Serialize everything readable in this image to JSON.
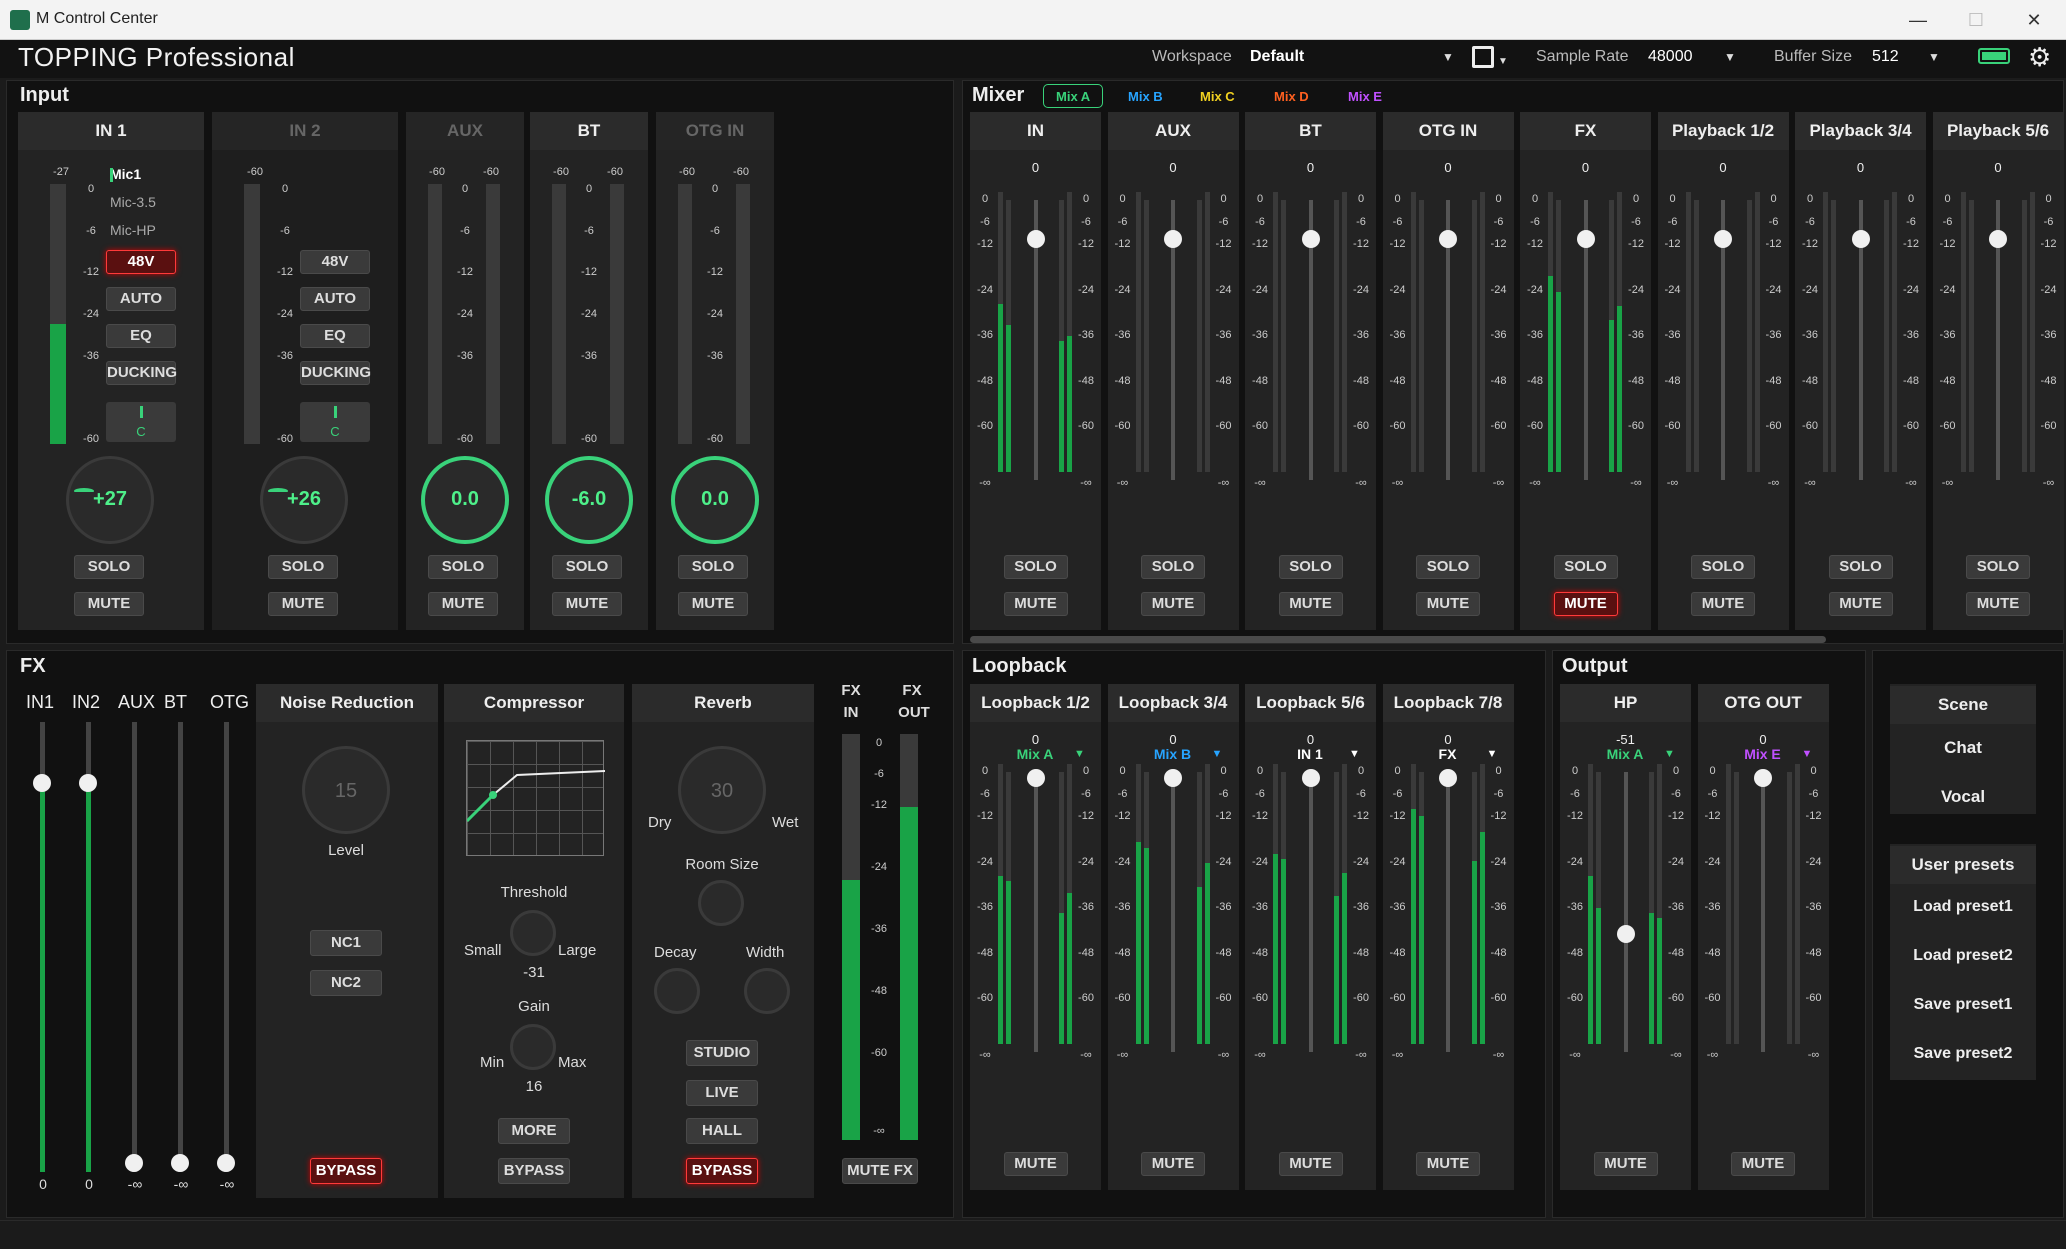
{
  "window": {
    "title": "M Control Center",
    "minimize": "—",
    "maximize": "☐",
    "close": "✕"
  },
  "header": {
    "brand": "TOPPING Professional",
    "workspace_label": "Workspace",
    "workspace_value": "Default",
    "sample_rate_label": "Sample Rate",
    "sample_rate_value": "48000",
    "buffer_label": "Buffer Size",
    "buffer_value": "512",
    "save_icon": "save-icon",
    "settings_icon": "gear-icon",
    "battery_icon": "battery-icon"
  },
  "input": {
    "title": "Input",
    "channels": [
      {
        "label": "IN 1",
        "top_tick": "-27",
        "sources": [
          "Mic1",
          "Mic-3.5",
          "Mic-HP"
        ],
        "buttons": [
          "48V",
          "AUTO",
          "EQ",
          "DUCKING"
        ],
        "pan": "C",
        "gain": "+27",
        "solo": "SOLO",
        "mute": "MUTE",
        "level": 0.46
      },
      {
        "label": "IN 2",
        "top_tick": "-60",
        "buttons": [
          "48V",
          "AUTO",
          "EQ",
          "DUCKING"
        ],
        "pan": "C",
        "gain": "+26",
        "solo": "SOLO",
        "mute": "MUTE"
      },
      {
        "label": "AUX",
        "gain": "0.0",
        "solo": "SOLO",
        "mute": "MUTE"
      },
      {
        "label": "BT",
        "gain": "-6.0",
        "solo": "SOLO",
        "mute": "MUTE"
      },
      {
        "label": "OTG IN",
        "gain": "0.0",
        "solo": "SOLO",
        "mute": "MUTE"
      }
    ],
    "scale": [
      "0",
      "-6",
      "-12",
      "-24",
      "-36",
      "-60"
    ],
    "scale_top": "-60"
  },
  "mixer": {
    "title": "Mixer",
    "tabs": [
      {
        "label": "Mix A",
        "color": "#39d27a"
      },
      {
        "label": "Mix B",
        "color": "#27a4ff"
      },
      {
        "label": "Mix C",
        "color": "#f0d020"
      },
      {
        "label": "Mix D",
        "color": "#ff6020"
      },
      {
        "label": "Mix E",
        "color": "#c050ff"
      }
    ],
    "channels": [
      {
        "label": "IN",
        "value": "0"
      },
      {
        "label": "AUX",
        "value": "0"
      },
      {
        "label": "BT",
        "value": "0"
      },
      {
        "label": "OTG IN",
        "value": "0"
      },
      {
        "label": "FX",
        "value": "0"
      },
      {
        "label": "Playback 1/2",
        "value": "0"
      },
      {
        "label": "Playback 3/4",
        "value": "0"
      },
      {
        "label": "Playback 5/6",
        "value": "0"
      }
    ],
    "scale": [
      "0",
      "-6",
      "-12",
      "-24",
      "-36",
      "-48",
      "-60",
      "-∞"
    ],
    "solo": "SOLO",
    "mute": "MUTE"
  },
  "fx": {
    "title": "FX",
    "sends": [
      {
        "label": "IN1",
        "value": "0"
      },
      {
        "label": "IN2",
        "value": "0"
      },
      {
        "label": "AUX",
        "value": "-∞"
      },
      {
        "label": "BT",
        "value": "-∞"
      },
      {
        "label": "OTG",
        "value": "-∞"
      }
    ],
    "noise_reduction": {
      "title": "Noise Reduction",
      "level_value": "15",
      "level_label": "Level",
      "nc1": "NC1",
      "nc2": "NC2",
      "bypass": "BYPASS"
    },
    "compressor": {
      "title": "Compressor",
      "threshold_label": "Threshold",
      "small": "Small",
      "large": "Large",
      "threshold_value": "-31",
      "gain_label": "Gain",
      "min": "Min",
      "max": "Max",
      "gain_value": "16",
      "more": "MORE",
      "bypass": "BYPASS"
    },
    "reverb": {
      "title": "Reverb",
      "value": "30",
      "dry": "Dry",
      "wet": "Wet",
      "room_size": "Room Size",
      "decay": "Decay",
      "width": "Width",
      "studio": "STUDIO",
      "live": "LIVE",
      "hall": "HALL",
      "bypass": "BYPASS"
    },
    "fx_in": "FX\nIN",
    "fx_out": "FX\nOUT",
    "fx_in_label": "FX",
    "fx_in_label2": "IN",
    "fx_out_label": "FX",
    "fx_out_label2": "OUT",
    "scale": [
      "0",
      "-6",
      "-12",
      "-24",
      "-36",
      "-48",
      "-60",
      "-∞"
    ],
    "mute_fx": "MUTE FX"
  },
  "loopback": {
    "title": "Loopback",
    "channels": [
      {
        "label": "Loopback 1/2",
        "source": "Mix A",
        "color": "#39d27a",
        "value": "0"
      },
      {
        "label": "Loopback 3/4",
        "source": "Mix B",
        "color": "#27a4ff",
        "value": "0"
      },
      {
        "label": "Loopback 5/6",
        "source": "IN 1",
        "color": "#ffffff",
        "value": "0"
      },
      {
        "label": "Loopback 7/8",
        "source": "FX",
        "color": "#ffffff",
        "value": "0"
      }
    ],
    "mute": "MUTE",
    "scale": [
      "0",
      "-6",
      "-12",
      "-24",
      "-36",
      "-48",
      "-60",
      "-∞"
    ]
  },
  "output": {
    "title": "Output",
    "channels": [
      {
        "label": "HP",
        "source": "Mix A",
        "color": "#39d27a",
        "value": "-51"
      },
      {
        "label": "OTG OUT",
        "source": "Mix E",
        "color": "#c050ff",
        "value": "0"
      }
    ],
    "mute": "MUTE",
    "scale": [
      "0",
      "-6",
      "-12",
      "-24",
      "-36",
      "-48",
      "-60",
      "-∞"
    ]
  },
  "scene": {
    "title": "Scene",
    "items": [
      "Chat",
      "Vocal"
    ]
  },
  "presets": {
    "title": "User presets",
    "items": [
      "Load preset1",
      "Load preset2",
      "Save preset1",
      "Save preset2"
    ]
  }
}
